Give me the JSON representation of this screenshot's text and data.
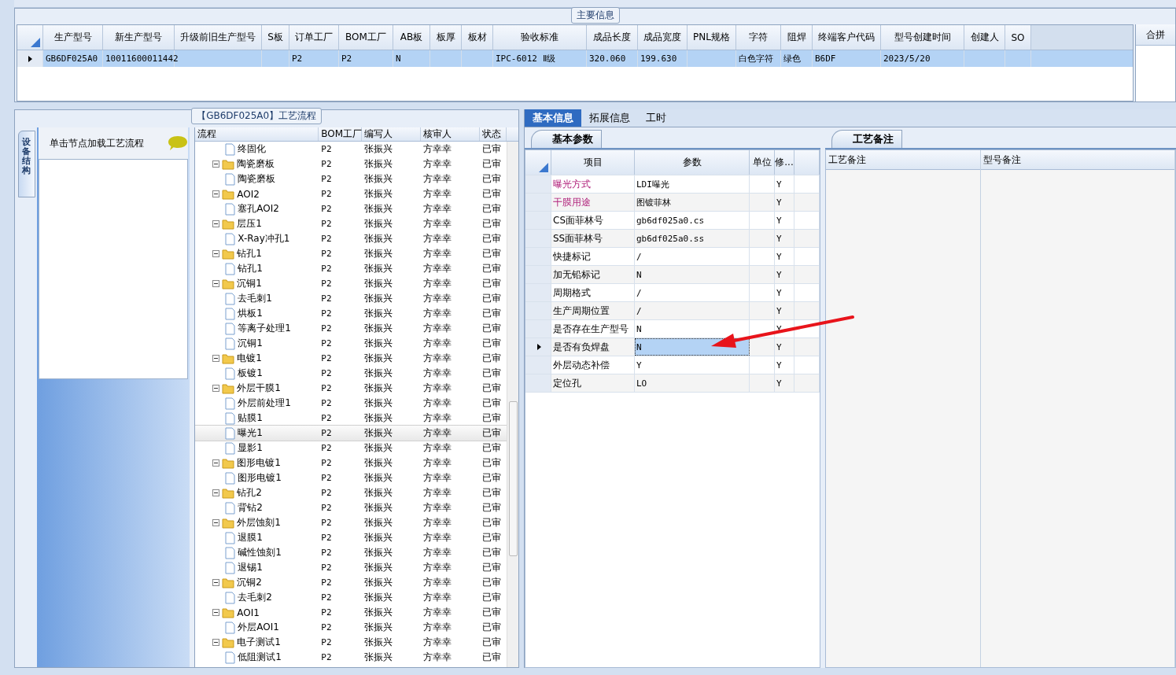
{
  "main_info": {
    "title": "主要信息",
    "columns": [
      "生产型号",
      "新生产型号",
      "升级前旧生产型号",
      "S板",
      "订单工厂",
      "BOM工厂",
      "AB板",
      "板厚",
      "板材",
      "验收标准",
      "成品长度",
      "成品宽度",
      "PNL规格",
      "字符",
      "阻焊",
      "终端客户代码",
      "型号创建时间",
      "创建人",
      "SO"
    ],
    "rows": [
      {
        "selected": true,
        "cells": [
          "GB6DF025A0",
          "10011600011442",
          "",
          "",
          "P2",
          "P2",
          "N",
          "",
          "",
          "IPC-6012 Ⅱ级",
          "320.060",
          "199.630",
          "",
          "白色字符",
          "绿色",
          "B6DF",
          "2023/5/20",
          "",
          ""
        ]
      }
    ],
    "side_panel": {
      "title": "合拼"
    }
  },
  "process": {
    "title": "【GB6DF025A0】工艺流程",
    "side_tab": "设备结构",
    "hint": "单击节点加载工艺流程",
    "columns": [
      "流程",
      "BOM工厂",
      "编写人",
      "核审人",
      "状态"
    ],
    "tree": [
      {
        "children": [
          {
            "label": "终固化",
            "bom": "P2",
            "writer": "张振兴",
            "reviewer": "方幸幸",
            "status": "已审",
            "selected": false
          }
        ]
      },
      {
        "label": "陶瓷磨板",
        "bom": "P2",
        "writer": "张振兴",
        "reviewer": "方幸幸",
        "status": "已审",
        "selected": false,
        "expanded": true,
        "children": [
          {
            "label": "陶瓷磨板",
            "bom": "P2",
            "writer": "张振兴",
            "reviewer": "方幸幸",
            "status": "已审",
            "selected": false
          }
        ]
      },
      {
        "label": "AOI2",
        "bom": "P2",
        "writer": "张振兴",
        "reviewer": "方幸幸",
        "status": "已审",
        "selected": false,
        "expanded": true,
        "children": [
          {
            "label": "塞孔AOI2",
            "bom": "P2",
            "writer": "张振兴",
            "reviewer": "方幸幸",
            "status": "已审",
            "selected": false
          }
        ]
      },
      {
        "label": "层压1",
        "bom": "P2",
        "writer": "张振兴",
        "reviewer": "方幸幸",
        "status": "已审",
        "selected": false,
        "expanded": true,
        "children": [
          {
            "label": "X-Ray冲孔1",
            "bom": "P2",
            "writer": "张振兴",
            "reviewer": "方幸幸",
            "status": "已审",
            "selected": false
          }
        ]
      },
      {
        "label": "钻孔1",
        "bom": "P2",
        "writer": "张振兴",
        "reviewer": "方幸幸",
        "status": "已审",
        "selected": false,
        "expanded": true,
        "children": [
          {
            "label": "钻孔1",
            "bom": "P2",
            "writer": "张振兴",
            "reviewer": "方幸幸",
            "status": "已审",
            "selected": false
          }
        ]
      },
      {
        "label": "沉铜1",
        "bom": "P2",
        "writer": "张振兴",
        "reviewer": "方幸幸",
        "status": "已审",
        "selected": false,
        "expanded": true,
        "children": [
          {
            "label": "去毛刺1",
            "bom": "P2",
            "writer": "张振兴",
            "reviewer": "方幸幸",
            "status": "已审",
            "selected": false
          },
          {
            "label": "烘板1",
            "bom": "P2",
            "writer": "张振兴",
            "reviewer": "方幸幸",
            "status": "已审",
            "selected": false
          },
          {
            "label": "等离子处理1",
            "bom": "P2",
            "writer": "张振兴",
            "reviewer": "方幸幸",
            "status": "已审",
            "selected": false
          },
          {
            "label": "沉铜1",
            "bom": "P2",
            "writer": "张振兴",
            "reviewer": "方幸幸",
            "status": "已审",
            "selected": false
          }
        ]
      },
      {
        "label": "电镀1",
        "bom": "P2",
        "writer": "张振兴",
        "reviewer": "方幸幸",
        "status": "已审",
        "selected": false,
        "expanded": true,
        "children": [
          {
            "label": "板镀1",
            "bom": "P2",
            "writer": "张振兴",
            "reviewer": "方幸幸",
            "status": "已审",
            "selected": false
          }
        ]
      },
      {
        "label": "外层干膜1",
        "bom": "P2",
        "writer": "张振兴",
        "reviewer": "方幸幸",
        "status": "已审",
        "selected": false,
        "expanded": true,
        "children": [
          {
            "label": "外层前处理1",
            "bom": "P2",
            "writer": "张振兴",
            "reviewer": "方幸幸",
            "status": "已审",
            "selected": false
          },
          {
            "label": "贴膜1",
            "bom": "P2",
            "writer": "张振兴",
            "reviewer": "方幸幸",
            "status": "已审",
            "selected": false
          },
          {
            "label": "曝光1",
            "bom": "P2",
            "writer": "张振兴",
            "reviewer": "方幸幸",
            "status": "已审",
            "selected": true
          },
          {
            "label": "显影1",
            "bom": "P2",
            "writer": "张振兴",
            "reviewer": "方幸幸",
            "status": "已审",
            "selected": false
          }
        ]
      },
      {
        "label": "图形电镀1",
        "bom": "P2",
        "writer": "张振兴",
        "reviewer": "方幸幸",
        "status": "已审",
        "selected": false,
        "expanded": true,
        "children": [
          {
            "label": "图形电镀1",
            "bom": "P2",
            "writer": "张振兴",
            "reviewer": "方幸幸",
            "status": "已审",
            "selected": false
          }
        ]
      },
      {
        "label": "钻孔2",
        "bom": "P2",
        "writer": "张振兴",
        "reviewer": "方幸幸",
        "status": "已审",
        "selected": false,
        "expanded": true,
        "children": [
          {
            "label": "背钻2",
            "bom": "P2",
            "writer": "张振兴",
            "reviewer": "方幸幸",
            "status": "已审",
            "selected": false
          }
        ]
      },
      {
        "label": "外层蚀刻1",
        "bom": "P2",
        "writer": "张振兴",
        "reviewer": "方幸幸",
        "status": "已审",
        "selected": false,
        "expanded": true,
        "children": [
          {
            "label": "退膜1",
            "bom": "P2",
            "writer": "张振兴",
            "reviewer": "方幸幸",
            "status": "已审",
            "selected": false
          },
          {
            "label": "碱性蚀刻1",
            "bom": "P2",
            "writer": "张振兴",
            "reviewer": "方幸幸",
            "status": "已审",
            "selected": false
          },
          {
            "label": "退锡1",
            "bom": "P2",
            "writer": "张振兴",
            "reviewer": "方幸幸",
            "status": "已审",
            "selected": false
          }
        ]
      },
      {
        "label": "沉铜2",
        "bom": "P2",
        "writer": "张振兴",
        "reviewer": "方幸幸",
        "status": "已审",
        "selected": false,
        "expanded": true,
        "children": [
          {
            "label": "去毛刺2",
            "bom": "P2",
            "writer": "张振兴",
            "reviewer": "方幸幸",
            "status": "已审",
            "selected": false
          }
        ]
      },
      {
        "label": "AOI1",
        "bom": "P2",
        "writer": "张振兴",
        "reviewer": "方幸幸",
        "status": "已审",
        "selected": false,
        "expanded": true,
        "children": [
          {
            "label": "外层AOI1",
            "bom": "P2",
            "writer": "张振兴",
            "reviewer": "方幸幸",
            "status": "已审",
            "selected": false
          }
        ]
      },
      {
        "label": "电子测试1",
        "bom": "P2",
        "writer": "张振兴",
        "reviewer": "方幸幸",
        "status": "已审",
        "selected": false,
        "expanded": true,
        "children": [
          {
            "label": "低阻测试1",
            "bom": "P2",
            "writer": "张振兴",
            "reviewer": "方幸幸",
            "status": "已审",
            "selected": false
          }
        ]
      }
    ]
  },
  "details": {
    "tabs": [
      {
        "label": "基本信息",
        "selected": true
      },
      {
        "label": "拓展信息",
        "selected": false
      },
      {
        "label": "工时",
        "selected": false
      }
    ],
    "params": {
      "tab": "基本参数",
      "columns": [
        "项目",
        "参数",
        "单位",
        "修..."
      ],
      "rows": [
        {
          "item": "曝光方式",
          "value": "LDI曝光",
          "modified": "Y",
          "highlighted": true,
          "selected": false
        },
        {
          "item": "干膜用途",
          "value": "图镀菲林",
          "modified": "Y",
          "highlighted": true,
          "selected": false
        },
        {
          "item": "CS面菲林号",
          "value": "gb6df025a0.cs",
          "modified": "Y",
          "highlighted": false,
          "selected": false
        },
        {
          "item": "SS面菲林号",
          "value": "gb6df025a0.ss",
          "modified": "Y",
          "highlighted": false,
          "selected": false
        },
        {
          "item": "快捷标记",
          "value": "/",
          "modified": "Y",
          "highlighted": false,
          "selected": false
        },
        {
          "item": "加无铅标记",
          "value": "N",
          "modified": "Y",
          "highlighted": false,
          "selected": false
        },
        {
          "item": "周期格式",
          "value": "/",
          "modified": "Y",
          "highlighted": false,
          "selected": false
        },
        {
          "item": "生产周期位置",
          "value": "/",
          "modified": "Y",
          "highlighted": false,
          "selected": false
        },
        {
          "item": "是否存在生产型号",
          "value": "N",
          "modified": "Y",
          "highlighted": false,
          "selected": false
        },
        {
          "item": "是否有负焊盘",
          "value": "N",
          "modified": "Y",
          "highlighted": false,
          "selected": true
        },
        {
          "item": "外层动态补偿",
          "value": "Y",
          "modified": "Y",
          "highlighted": false,
          "selected": false
        },
        {
          "item": "定位孔",
          "value": "LO",
          "modified": "Y",
          "highlighted": false,
          "selected": false
        }
      ]
    },
    "notes": {
      "tab": "工艺备注",
      "columns": [
        "工艺备注",
        "型号备注"
      ]
    }
  }
}
